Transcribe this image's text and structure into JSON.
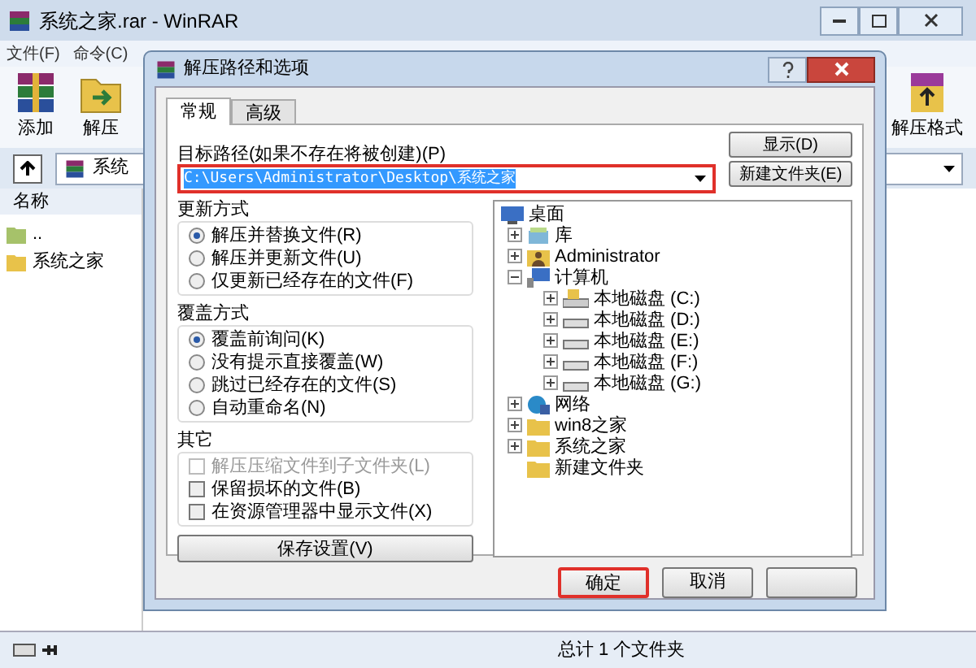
{
  "window": {
    "title": "系统之家.rar - WinRAR"
  },
  "menu": [
    "文件(F)",
    "命令(C)"
  ],
  "toolbar": [
    {
      "label": "添加",
      "kind": "add"
    },
    {
      "label": "解压",
      "kind": "extract"
    }
  ],
  "toolbar_right": {
    "label": "解压格式"
  },
  "address": {
    "value": "系统"
  },
  "file_list": {
    "column": "名称",
    "rows": [
      {
        "name": "..",
        "kind": "up"
      },
      {
        "name": "系统之家",
        "kind": "folder"
      }
    ]
  },
  "status_bar": {
    "text": "总计 1 个文件夹"
  },
  "dialog": {
    "title": "解压路径和选项",
    "tabs": [
      {
        "label": "常规",
        "selected": true
      },
      {
        "label": "高级",
        "selected": false
      }
    ],
    "path_label": "目标路径(如果不存在将被创建)(P)",
    "path": {
      "value": "C:\\Users\\Administrator\\Desktop\\系统之家",
      "highlighted": true
    },
    "side_buttons": [
      "显示(D)",
      "新建文件夹(E)"
    ],
    "groups": [
      {
        "title": "更新方式",
        "items": [
          {
            "label": "解压并替换文件(R)",
            "kind": "radio",
            "selected": true
          },
          {
            "label": "解压并更新文件(U)",
            "kind": "radio",
            "selected": false
          },
          {
            "label": "仅更新已经存在的文件(F)",
            "kind": "radio",
            "selected": false
          }
        ]
      },
      {
        "title": "覆盖方式",
        "items": [
          {
            "label": "覆盖前询问(K)",
            "kind": "radio",
            "selected": true
          },
          {
            "label": "没有提示直接覆盖(W)",
            "kind": "radio",
            "selected": false
          },
          {
            "label": "跳过已经存在的文件(S)",
            "kind": "radio",
            "selected": false
          },
          {
            "label": "自动重命名(N)",
            "kind": "radio",
            "selected": false
          }
        ]
      },
      {
        "title": "其它",
        "items": [
          {
            "label": "解压压缩文件到子文件夹(L)",
            "kind": "checkbox",
            "checked": false,
            "disabled": true
          },
          {
            "label": "保留损坏的文件(B)",
            "kind": "checkbox",
            "checked": false,
            "disabled": false
          },
          {
            "label": "在资源管理器中显示文件(X)",
            "kind": "checkbox",
            "checked": false,
            "disabled": false
          }
        ]
      }
    ],
    "save_button": "保存设置(V)",
    "tree": [
      {
        "label": "桌面",
        "kind": "desktop",
        "children": [
          {
            "label": "库",
            "kind": "library",
            "expanded": false
          },
          {
            "label": "Administrator",
            "kind": "user",
            "expanded": false
          },
          {
            "label": "计算机",
            "kind": "computer",
            "expanded": true,
            "children": [
              {
                "label": "本地磁盘 (C:)",
                "kind": "system-drive",
                "expanded": false
              },
              {
                "label": "本地磁盘 (D:)",
                "kind": "drive",
                "expanded": false
              },
              {
                "label": "本地磁盘 (E:)",
                "kind": "drive",
                "expanded": false
              },
              {
                "label": "本地磁盘 (F:)",
                "kind": "drive",
                "expanded": false
              },
              {
                "label": "本地磁盘 (G:)",
                "kind": "drive",
                "expanded": false
              }
            ]
          },
          {
            "label": "网络",
            "kind": "network",
            "expanded": false
          },
          {
            "label": "win8之家",
            "kind": "folder",
            "expanded": false
          },
          {
            "label": "系统之家",
            "kind": "folder",
            "expanded": false
          },
          {
            "label": "新建文件夹",
            "kind": "folder"
          }
        ]
      }
    ],
    "buttons": [
      {
        "label": "确定",
        "highlighted": true
      },
      {
        "label": "取消",
        "highlighted": false
      }
    ]
  }
}
